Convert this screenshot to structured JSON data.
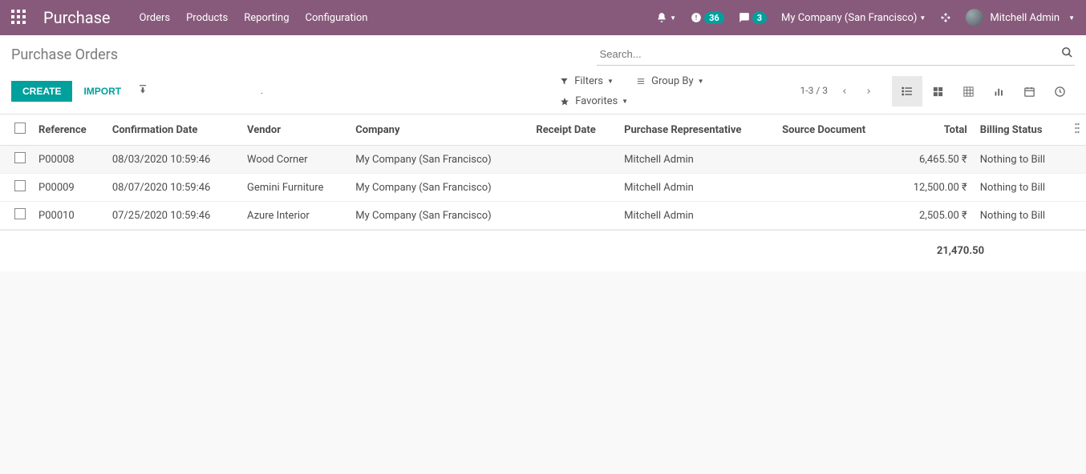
{
  "navbar": {
    "app_title": "Purchase",
    "menu": [
      "Orders",
      "Products",
      "Reporting",
      "Configuration"
    ],
    "badges": {
      "activity": "36",
      "messages": "3"
    },
    "company": "My Company (San Francisco)",
    "user": "Mitchell Admin"
  },
  "breadcrumb": "Purchase Orders",
  "buttons": {
    "create": "CREATE",
    "import": "IMPORT"
  },
  "search_placeholder": "Search...",
  "search_options": {
    "filters": "Filters",
    "groupby": "Group By",
    "favorites": "Favorites"
  },
  "pager": "1-3 / 3",
  "columns": {
    "reference": "Reference",
    "confirmation_date": "Confirmation Date",
    "vendor": "Vendor",
    "company": "Company",
    "receipt_date": "Receipt Date",
    "purchase_rep": "Purchase Representative",
    "source_doc": "Source Document",
    "total": "Total",
    "billing_status": "Billing Status"
  },
  "rows": [
    {
      "ref": "P00008",
      "conf": "08/03/2020 10:59:46",
      "vendor": "Wood Corner",
      "company": "My Company (San Francisco)",
      "receipt": "",
      "rep": "Mitchell Admin",
      "source": "",
      "total": "6,465.50 ₹",
      "billing": "Nothing to Bill"
    },
    {
      "ref": "P00009",
      "conf": "08/07/2020 10:59:46",
      "vendor": "Gemini Furniture",
      "company": "My Company (San Francisco)",
      "receipt": "",
      "rep": "Mitchell Admin",
      "source": "",
      "total": "12,500.00 ₹",
      "billing": "Nothing to Bill"
    },
    {
      "ref": "P00010",
      "conf": "07/25/2020 10:59:46",
      "vendor": "Azure Interior",
      "company": "My Company (San Francisco)",
      "receipt": "",
      "rep": "Mitchell Admin",
      "source": "",
      "total": "2,505.00 ₹",
      "billing": "Nothing to Bill"
    }
  ],
  "grand_total": "21,470.50"
}
